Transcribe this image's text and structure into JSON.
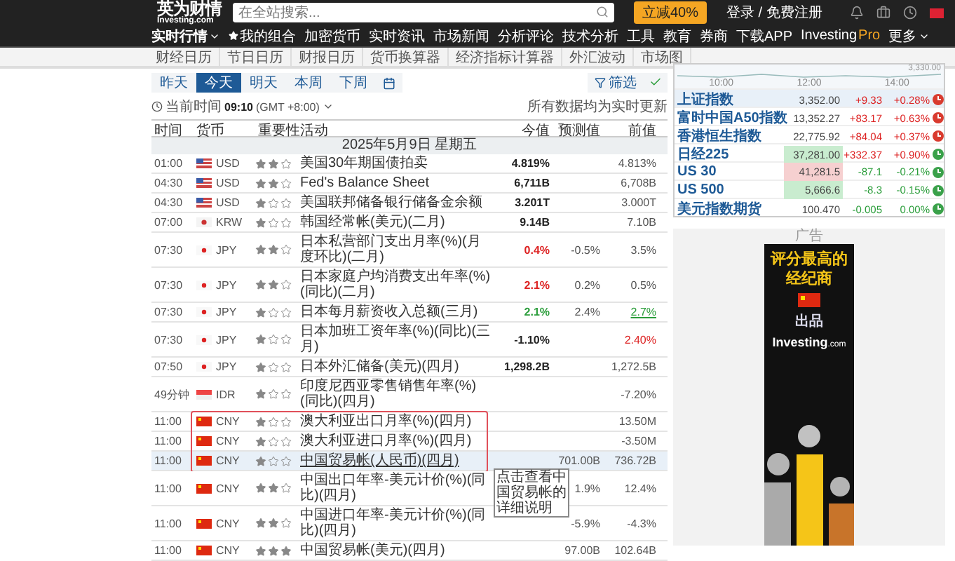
{
  "logo": {
    "title": "英为财情",
    "subtitle": "Investing.com"
  },
  "search": {
    "placeholder": "在全站搜索..."
  },
  "promo_button": "立减40%",
  "login": "登录 / 免费注册",
  "nav": [
    {
      "label": "实时行情",
      "kind": "dropdown"
    },
    {
      "label": "我的组合",
      "kind": "starred"
    },
    {
      "label": "加密货币",
      "kind": "plain"
    },
    {
      "label": "实时资讯",
      "kind": "plain"
    },
    {
      "label": "市场新闻",
      "kind": "plain"
    },
    {
      "label": "分析评论",
      "kind": "plain"
    },
    {
      "label": "技术分析",
      "kind": "plain"
    },
    {
      "label": "工具",
      "kind": "plain"
    },
    {
      "label": "教育",
      "kind": "plain"
    },
    {
      "label": "券商",
      "kind": "plain"
    },
    {
      "label": "下载APP",
      "kind": "plain"
    },
    {
      "label": "Investing",
      "label_suffix": "Pro",
      "kind": "pro"
    },
    {
      "label": "更多",
      "kind": "dropdown"
    }
  ],
  "subnav": [
    "财经日历",
    "节日日历",
    "财报日历",
    "货币换算器",
    "经济指标计算器",
    "外汇波动",
    "市场图"
  ],
  "date_tabs": [
    {
      "label": "昨天",
      "selected": false
    },
    {
      "label": "今天",
      "selected": true
    },
    {
      "label": "明天",
      "selected": false
    },
    {
      "label": "本周",
      "selected": false
    },
    {
      "label": "下周",
      "selected": false
    }
  ],
  "filter_button": "筛选",
  "current_time": {
    "label": "当前时间",
    "time": "09:10",
    "zone": "(GMT +8:00)"
  },
  "realtime_note": "所有数据均为实时更新",
  "table": {
    "columns": [
      "时间",
      "货币",
      "重要性",
      "活动",
      "今值",
      "预测值",
      "前值"
    ],
    "date_heading": "2025年5月9日 星期五",
    "tooltip": "点击查看中国贸易帐的详细说明",
    "rows": [
      {
        "time": "01:00",
        "kind": "us",
        "currency": "USD",
        "stars": 2,
        "event": "美国30年期国债拍卖",
        "actual": "4.819%",
        "previous": "4.813%"
      },
      {
        "time": "04:30",
        "kind": "us",
        "currency": "USD",
        "stars": 2,
        "event": "Fed's Balance Sheet",
        "actual": "6,711B",
        "previous": "6,708B"
      },
      {
        "time": "04:30",
        "kind": "us",
        "currency": "USD",
        "stars": 1,
        "event": "美国联邦储备银行储备金余额",
        "actual": "3.201T",
        "previous": "3.000T"
      },
      {
        "time": "07:00",
        "kind": "kr",
        "currency": "KRW",
        "stars": 1,
        "event": "韩国经常帐(美元)(二月)",
        "actual": "9.14B",
        "previous": "7.10B"
      },
      {
        "time": "07:30",
        "kind": "jp",
        "currency": "JPY",
        "stars": 2,
        "event": "日本私营部门支出月率(%)(月度环比)(二月)",
        "actual": "0.4%",
        "actual_beat": false,
        "forecast": "-0.5%",
        "previous": "3.5%"
      },
      {
        "time": "07:30",
        "kind": "jp",
        "currency": "JPY",
        "stars": 2,
        "event": "日本家庭户均消费支出年率(%)(同比)(二月)",
        "actual": "2.1%",
        "actual_beat": false,
        "forecast": "0.2%",
        "previous": "0.5%"
      },
      {
        "time": "07:30",
        "kind": "jp",
        "currency": "JPY",
        "stars": 1,
        "event": "日本每月薪资收入总额(三月)",
        "actual": "2.1%",
        "actual_beat": true,
        "forecast": "2.4%",
        "previous": "2.7%",
        "previous_beat": true
      },
      {
        "time": "07:30",
        "kind": "jp",
        "currency": "JPY",
        "stars": 1,
        "event": "日本加班工资年率(%)(同比)(三月)",
        "actual": "-1.10%",
        "previous": "2.40%",
        "previous_beat": false
      },
      {
        "time": "07:50",
        "kind": "jp",
        "currency": "JPY",
        "stars": 1,
        "event": "日本外汇储备(美元)(四月)",
        "actual": "1,298.2B",
        "previous": "1,272.5B"
      },
      {
        "time": "49分钟",
        "kind": "id",
        "currency": "IDR",
        "stars": 1,
        "event": "印度尼西亚零售销售年率(%)(同比)(四月)",
        "previous": "-7.20%"
      },
      {
        "time": "11:00",
        "kind": "cn",
        "currency": "CNY",
        "stars": 1,
        "event": "澳大利亚出口月率(%)(四月)",
        "previous": "13.50M",
        "framed": true
      },
      {
        "time": "11:00",
        "kind": "cn",
        "currency": "CNY",
        "stars": 1,
        "event": "澳大利亚进口月率(%)(四月)",
        "previous": "-3.50M",
        "framed": true
      },
      {
        "time": "11:00",
        "kind": "cn",
        "currency": "CNY",
        "stars": 1,
        "event": "中国贸易帐(人民币)(四月)",
        "forecast": "701.00B",
        "previous": "736.72B",
        "framed": true,
        "hovered": true
      },
      {
        "time": "11:00",
        "kind": "cn",
        "currency": "CNY",
        "stars": 2,
        "event": "中国出口年率-美元计价(%)(同比)(四月)",
        "forecast": "1.9%",
        "previous": "12.4%"
      },
      {
        "time": "11:00",
        "kind": "cn",
        "currency": "CNY",
        "stars": 2,
        "event": "中国进口年率-美元计价(%)(同比)(四月)",
        "forecast": "-5.9%",
        "previous": "-4.3%"
      },
      {
        "time": "11:00",
        "kind": "cn",
        "currency": "CNY",
        "stars": 3,
        "event": "中国贸易帐(美元)(四月)",
        "forecast": "97.00B",
        "previous": "102.64B"
      }
    ]
  },
  "index_widget": {
    "chart_label": "3,330.00",
    "times": [
      "10:00",
      "12:00",
      "14:00"
    ],
    "rows": [
      {
        "name": "上证指数",
        "value": "3,352.00",
        "change": "+9.33",
        "pct": "+0.28%",
        "rising": true,
        "color": "#d93b2f",
        "selected": true
      },
      {
        "name": "富时中国A50指数",
        "value": "13,352.27",
        "change": "+83.17",
        "pct": "+0.63%",
        "rising": true,
        "color": "#d93b2f",
        "selected": false
      },
      {
        "name": "香港恒生指数",
        "value": "22,775.92",
        "change": "+84.04",
        "pct": "+0.37%",
        "rising": true,
        "color": "#d93b2f",
        "selected": false
      },
      {
        "name": "日经225",
        "value": "37,281.00",
        "change": "+332.37",
        "pct": "+0.90%",
        "rising": true,
        "flash_up": true,
        "color": "#3aa14a",
        "selected": false
      },
      {
        "name": "US 30",
        "value": "41,281.5",
        "change": "-87.1",
        "pct": "-0.21%",
        "rising": false,
        "flash_up": false,
        "color": "#3aa14a",
        "selected": false
      },
      {
        "name": "US 500",
        "value": "5,666.6",
        "change": "-8.3",
        "pct": "-0.15%",
        "rising": false,
        "flash_up": true,
        "color": "#3aa14a",
        "selected": false
      },
      {
        "name": "美元指数期货",
        "value": "100.470",
        "change": "-0.005",
        "pct": "0.00%",
        "rising": false,
        "color": "#3aa14a",
        "selected": false
      }
    ]
  },
  "ad": {
    "label": "广告",
    "headline": "评分最高的经纪商",
    "byline": "出品",
    "brand": "Investing",
    "brand_suffix": ".com"
  }
}
